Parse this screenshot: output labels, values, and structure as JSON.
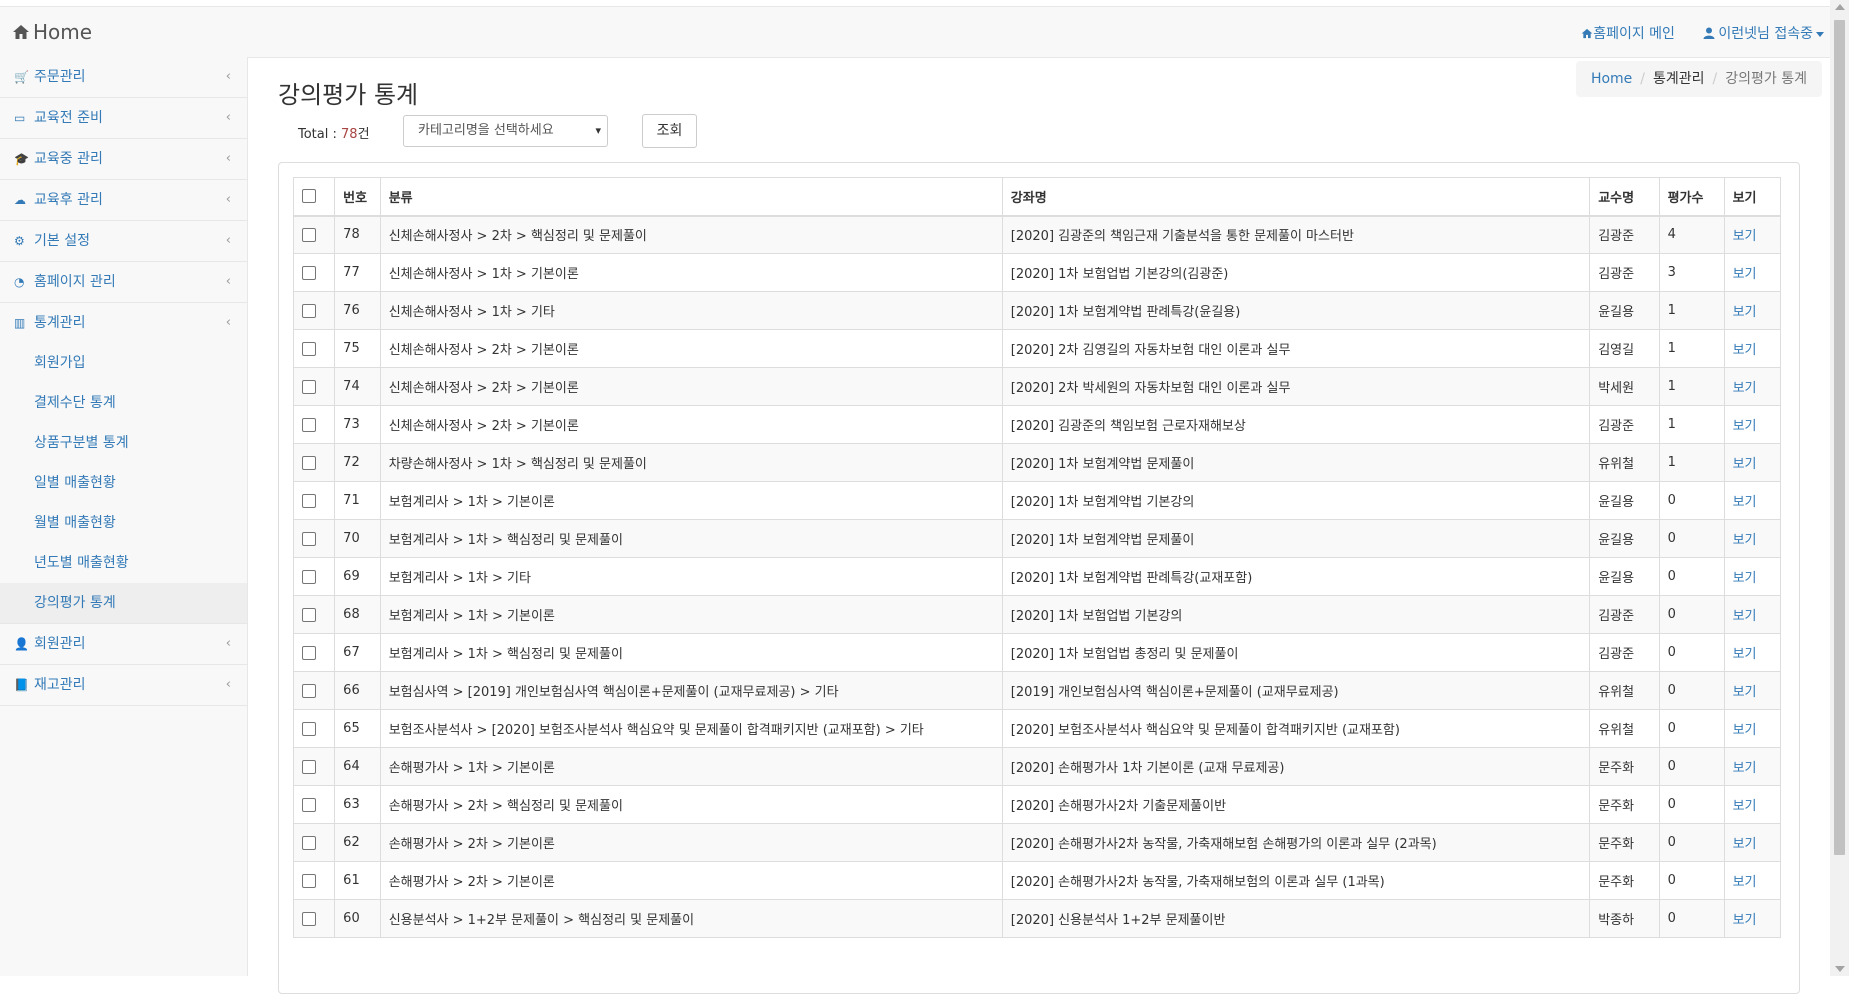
{
  "navbar": {
    "brand": "Home",
    "homepage_link": "홈페이지 메인",
    "user_link": "이런넷님 접속중"
  },
  "sidebar": {
    "items": [
      {
        "label": "주문관리",
        "icon": "cart-icon"
      },
      {
        "label": "교육전 준비",
        "icon": "laptop-icon"
      },
      {
        "label": "교육중 관리",
        "icon": "graduation-cap-icon"
      },
      {
        "label": "교육후 관리",
        "icon": "cloud-upload-icon"
      },
      {
        "label": "기본 설정",
        "icon": "gears-icon"
      },
      {
        "label": "홈페이지 관리",
        "icon": "dashboard-icon"
      },
      {
        "label": "통계관리",
        "icon": "bar-chart-icon"
      }
    ],
    "sub_items": [
      {
        "label": "회원가입"
      },
      {
        "label": "결제수단 통계"
      },
      {
        "label": "상품구분별 통계"
      },
      {
        "label": "일별 매출현황"
      },
      {
        "label": "월별 매출현황"
      },
      {
        "label": "년도별 매출현황"
      },
      {
        "label": "강의평가 통계"
      }
    ],
    "items_after": [
      {
        "label": "회원관리",
        "icon": "user-icon"
      },
      {
        "label": "재고관리",
        "icon": "book-icon"
      }
    ]
  },
  "page": {
    "title": "강의평가 통계",
    "breadcrumb": [
      "Home",
      "통계관리",
      "강의평가 통계"
    ],
    "total_label": "Total : ",
    "total_count": "78",
    "total_unit": "건",
    "category_placeholder": "카테고리명을 선택하세요",
    "search_button": "조회"
  },
  "table": {
    "headers": [
      "번호",
      "분류",
      "강좌명",
      "교수명",
      "평가수",
      "보기"
    ],
    "rows": [
      {
        "no": "78",
        "category": "신체손해사정사 > 2차 > 핵심정리 및 문제풀이",
        "course": "[2020] 김광준의 책임근재 기출분석을 통한 문제풀이 마스터반",
        "prof": "김광준",
        "count": "4",
        "view": "보기"
      },
      {
        "no": "77",
        "category": "신체손해사정사 > 1차 > 기본이론",
        "course": "[2020] 1차 보험업법 기본강의(김광준)",
        "prof": "김광준",
        "count": "3",
        "view": "보기"
      },
      {
        "no": "76",
        "category": "신체손해사정사 > 1차 > 기타",
        "course": "[2020] 1차 보험계약법 판례특강(윤길용)",
        "prof": "윤길용",
        "count": "1",
        "view": "보기"
      },
      {
        "no": "75",
        "category": "신체손해사정사 > 2차 > 기본이론",
        "course": "[2020] 2차 김영길의 자동차보험 대인 이론과 실무",
        "prof": "김영길",
        "count": "1",
        "view": "보기"
      },
      {
        "no": "74",
        "category": "신체손해사정사 > 2차 > 기본이론",
        "course": "[2020] 2차 박세원의 자동차보험 대인 이론과 실무",
        "prof": "박세원",
        "count": "1",
        "view": "보기"
      },
      {
        "no": "73",
        "category": "신체손해사정사 > 2차 > 기본이론",
        "course": "[2020] 김광준의 책임보험 근로자재해보상",
        "prof": "김광준",
        "count": "1",
        "view": "보기"
      },
      {
        "no": "72",
        "category": "차량손해사정사 > 1차 > 핵심정리 및 문제풀이",
        "course": "[2020] 1차 보험계약법 문제풀이",
        "prof": "유위철",
        "count": "1",
        "view": "보기"
      },
      {
        "no": "71",
        "category": "보험계리사 > 1차 > 기본이론",
        "course": "[2020] 1차 보험계약법 기본강의",
        "prof": "윤길용",
        "count": "0",
        "view": "보기"
      },
      {
        "no": "70",
        "category": "보험계리사 > 1차 > 핵심정리 및 문제풀이",
        "course": "[2020] 1차 보험계약법 문제풀이",
        "prof": "윤길용",
        "count": "0",
        "view": "보기"
      },
      {
        "no": "69",
        "category": "보험계리사 > 1차 > 기타",
        "course": "[2020] 1차 보험계약법 판례특강(교재포함)",
        "prof": "윤길용",
        "count": "0",
        "view": "보기"
      },
      {
        "no": "68",
        "category": "보험계리사 > 1차 > 기본이론",
        "course": "[2020] 1차 보험업법 기본강의",
        "prof": "김광준",
        "count": "0",
        "view": "보기"
      },
      {
        "no": "67",
        "category": "보험계리사 > 1차 > 핵심정리 및 문제풀이",
        "course": "[2020] 1차 보험업법 총정리 및 문제풀이",
        "prof": "김광준",
        "count": "0",
        "view": "보기"
      },
      {
        "no": "66",
        "category": "보험심사역 > [2019] 개인보험심사역 핵심이론+문제풀이 (교재무료제공) > 기타",
        "course": "[2019] 개인보험심사역 핵심이론+문제풀이 (교재무료제공)",
        "prof": "유위철",
        "count": "0",
        "view": "보기"
      },
      {
        "no": "65",
        "category": "보험조사분석사 > [2020] 보험조사분석사 핵심요약 및 문제풀이 합격패키지반 (교재포함) > 기타",
        "course": "[2020] 보험조사분석사 핵심요약 및 문제풀이 합격패키지반 (교재포함)",
        "prof": "유위철",
        "count": "0",
        "view": "보기"
      },
      {
        "no": "64",
        "category": "손해평가사 > 1차 > 기본이론",
        "course": "[2020] 손해평가사 1차 기본이론 (교재 무료제공)",
        "prof": "문주화",
        "count": "0",
        "view": "보기"
      },
      {
        "no": "63",
        "category": "손해평가사 > 2차 > 핵심정리 및 문제풀이",
        "course": "[2020] 손해평가사2차 기출문제풀이반",
        "prof": "문주화",
        "count": "0",
        "view": "보기"
      },
      {
        "no": "62",
        "category": "손해평가사 > 2차 > 기본이론",
        "course": "[2020] 손해평가사2차 농작물, 가축재해보험 손해평가의 이론과 실무 (2과목)",
        "prof": "문주화",
        "count": "0",
        "view": "보기"
      },
      {
        "no": "61",
        "category": "손해평가사 > 2차 > 기본이론",
        "course": "[2020] 손해평가사2차 농작물, 가축재해보험의 이론과 실무 (1과목)",
        "prof": "문주화",
        "count": "0",
        "view": "보기"
      },
      {
        "no": "60",
        "category": "신용분석사 > 1+2부 문제풀이 > 핵심정리 및 문제풀이",
        "course": "[2020] 신용분석사 1+2부 문제풀이반",
        "prof": "박종하",
        "count": "0",
        "view": "보기"
      }
    ]
  },
  "colors": {
    "link": "#337ab7",
    "total_count": "#a94442"
  }
}
